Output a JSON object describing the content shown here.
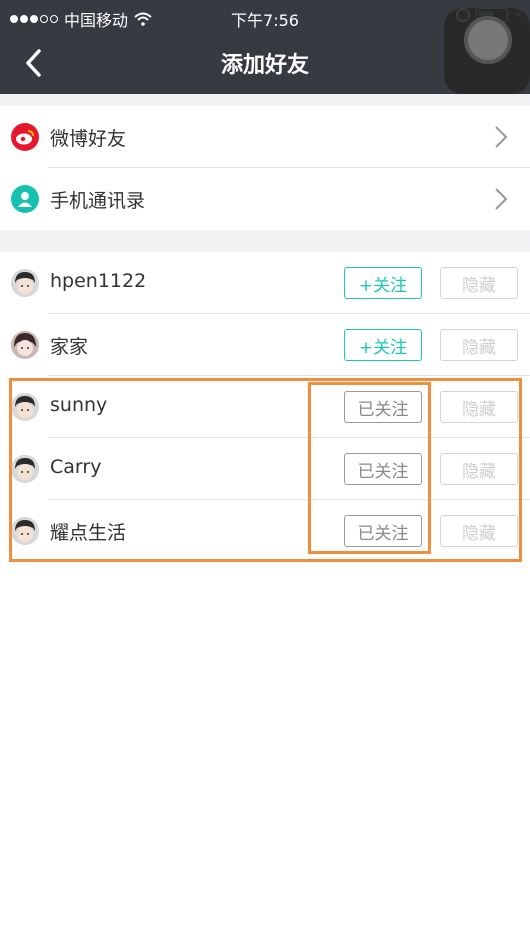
{
  "status_bar": {
    "carrier": "中国移动",
    "time": "下午7:56"
  },
  "nav": {
    "title": "添加好友"
  },
  "sources": [
    {
      "label": "微博好友",
      "icon": "weibo-icon"
    },
    {
      "label": "手机通讯录",
      "icon": "contact-icon"
    }
  ],
  "friends": [
    {
      "name": "hpen1122",
      "action": "+关注",
      "state": "follow",
      "hide": "隐藏"
    },
    {
      "name": "家家",
      "action": "+关注",
      "state": "follow",
      "hide": "隐藏"
    },
    {
      "name": "sunny",
      "action": "已关注",
      "state": "followed",
      "hide": "隐藏"
    },
    {
      "name": "Carry",
      "action": "已关注",
      "state": "followed",
      "hide": "隐藏"
    },
    {
      "name": "耀点生活",
      "action": "已关注",
      "state": "followed",
      "hide": "隐藏"
    }
  ],
  "colors": {
    "nav_bg": "#363a41",
    "accent": "#1ec7b5",
    "highlight": "#ef8f3e"
  }
}
